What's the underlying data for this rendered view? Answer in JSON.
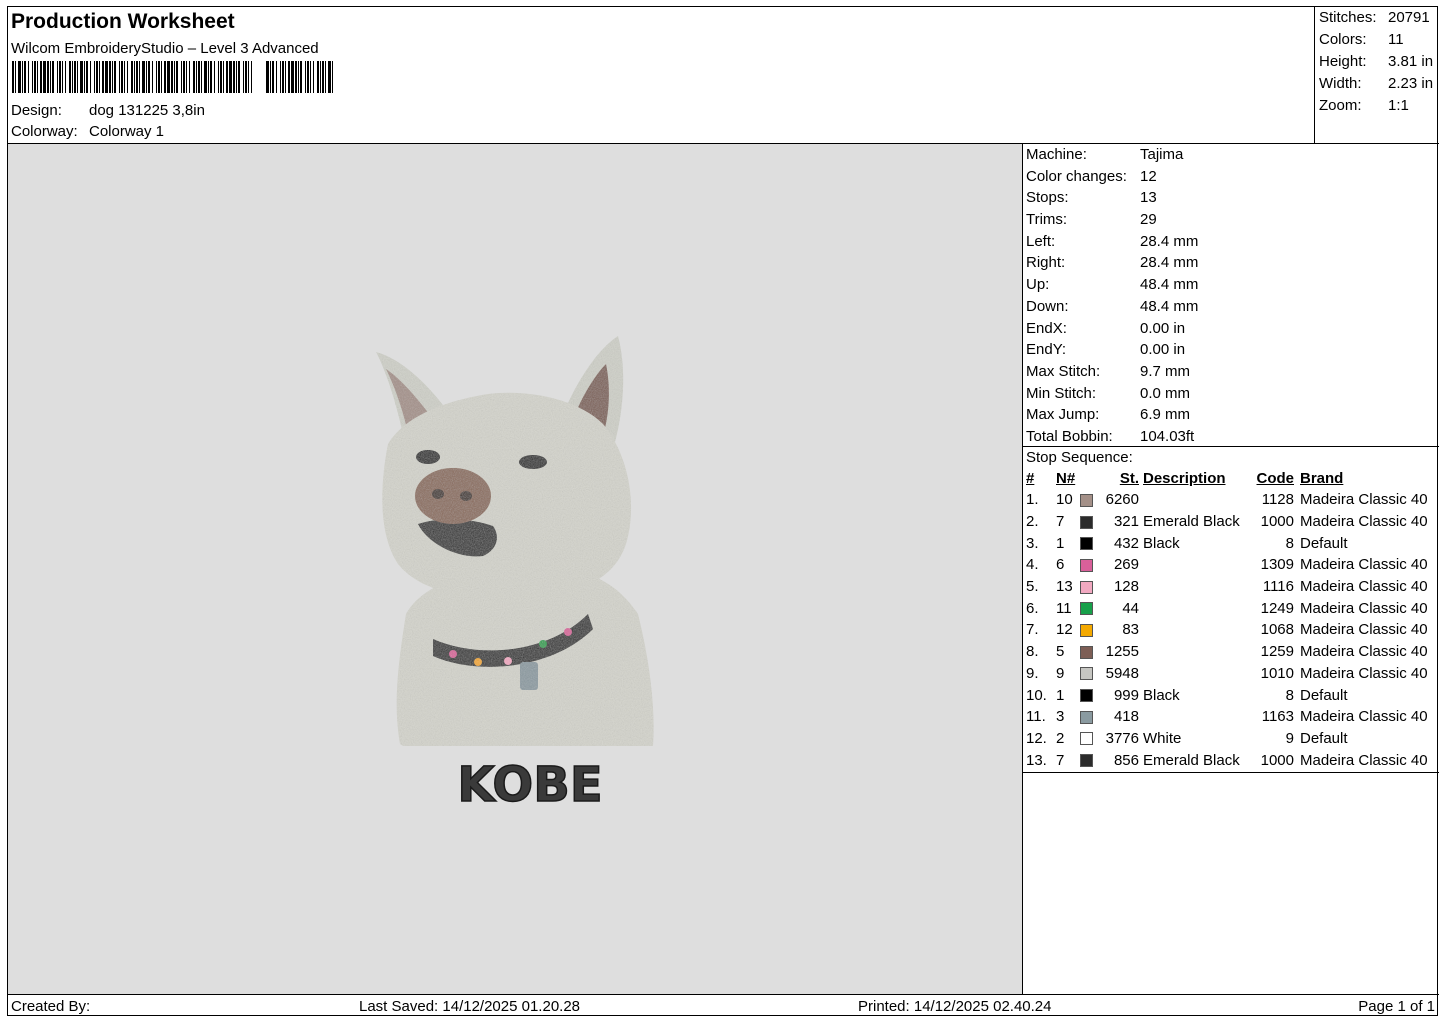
{
  "header": {
    "title": "Production Worksheet",
    "software": "Wilcom EmbroideryStudio – Level 3 Advanced",
    "design_label": "Design:",
    "design_value": "dog  131225 3,8in",
    "colorway_label": "Colorway:",
    "colorway_value": "Colorway 1"
  },
  "stats": [
    {
      "label": "Stitches:",
      "value": "20791"
    },
    {
      "label": "Colors:",
      "value": "11"
    },
    {
      "label": "Height:",
      "value": "3.81 in"
    },
    {
      "label": "Width:",
      "value": "2.23 in"
    },
    {
      "label": "Zoom:",
      "value": "1:1"
    }
  ],
  "design": {
    "name_text": "KOBE"
  },
  "machine_info": [
    {
      "label": "Machine:",
      "value": "Tajima"
    },
    {
      "label": "Color changes:",
      "value": "12"
    },
    {
      "label": "Stops:",
      "value": "13"
    },
    {
      "label": "Trims:",
      "value": "29"
    },
    {
      "label": "Left:",
      "value": "28.4 mm"
    },
    {
      "label": "Right:",
      "value": "28.4 mm"
    },
    {
      "label": "Up:",
      "value": "48.4 mm"
    },
    {
      "label": "Down:",
      "value": "48.4 mm"
    },
    {
      "label": "EndX:",
      "value": "0.00 in"
    },
    {
      "label": "EndY:",
      "value": "0.00 in"
    },
    {
      "label": "Max Stitch:",
      "value": "9.7 mm"
    },
    {
      "label": "Min Stitch:",
      "value": "0.0 mm"
    },
    {
      "label": "Max Jump:",
      "value": "6.9 mm"
    },
    {
      "label": "Total Bobbin:",
      "value": "104.03ft"
    }
  ],
  "stop_sequence": {
    "title": "Stop Sequence:",
    "headers": {
      "num": "#",
      "needle": "N#",
      "stitches": "St.",
      "description": "Description",
      "code": "Code",
      "brand": "Brand"
    },
    "rows": [
      {
        "num": "1.",
        "needle": "10",
        "color": "#a49088",
        "stitches": "6260",
        "description": "",
        "code": "1128",
        "brand": "Madeira Classic 40"
      },
      {
        "num": "2.",
        "needle": "7",
        "color": "#2b2b2b",
        "stitches": "321",
        "description": "Emerald Black",
        "code": "1000",
        "brand": "Madeira Classic 40"
      },
      {
        "num": "3.",
        "needle": "1",
        "color": "#000000",
        "stitches": "432",
        "description": "Black",
        "code": "8",
        "brand": "Default"
      },
      {
        "num": "4.",
        "needle": "6",
        "color": "#d9609a",
        "stitches": "269",
        "description": "",
        "code": "1309",
        "brand": "Madeira Classic 40"
      },
      {
        "num": "5.",
        "needle": "13",
        "color": "#f2a9c1",
        "stitches": "128",
        "description": "",
        "code": "1116",
        "brand": "Madeira Classic 40"
      },
      {
        "num": "6.",
        "needle": "11",
        "color": "#17a04a",
        "stitches": "44",
        "description": "",
        "code": "1249",
        "brand": "Madeira Classic 40"
      },
      {
        "num": "7.",
        "needle": "12",
        "color": "#f4a900",
        "stitches": "83",
        "description": "",
        "code": "1068",
        "brand": "Madeira Classic 40"
      },
      {
        "num": "8.",
        "needle": "5",
        "color": "#7d5e55",
        "stitches": "1255",
        "description": "",
        "code": "1259",
        "brand": "Madeira Classic 40"
      },
      {
        "num": "9.",
        "needle": "9",
        "color": "#c6c6c2",
        "stitches": "5948",
        "description": "",
        "code": "1010",
        "brand": "Madeira Classic 40"
      },
      {
        "num": "10.",
        "needle": "1",
        "color": "#000000",
        "stitches": "999",
        "description": "Black",
        "code": "8",
        "brand": "Default"
      },
      {
        "num": "11.",
        "needle": "3",
        "color": "#8a9aa0",
        "stitches": "418",
        "description": "",
        "code": "1163",
        "brand": "Madeira Classic 40"
      },
      {
        "num": "12.",
        "needle": "2",
        "color": "#ffffff",
        "stitches": "3776",
        "description": "White",
        "code": "9",
        "brand": "Default"
      },
      {
        "num": "13.",
        "needle": "7",
        "color": "#2b2b2b",
        "stitches": "856",
        "description": "Emerald Black",
        "code": "1000",
        "brand": "Madeira Classic 40"
      }
    ]
  },
  "footer": {
    "created_by": "Created By:",
    "last_saved": "Last Saved: 14/12/2025 01.20.28",
    "printed": "Printed: 14/12/2025 02.40.24",
    "page": "Page 1 of 1"
  }
}
